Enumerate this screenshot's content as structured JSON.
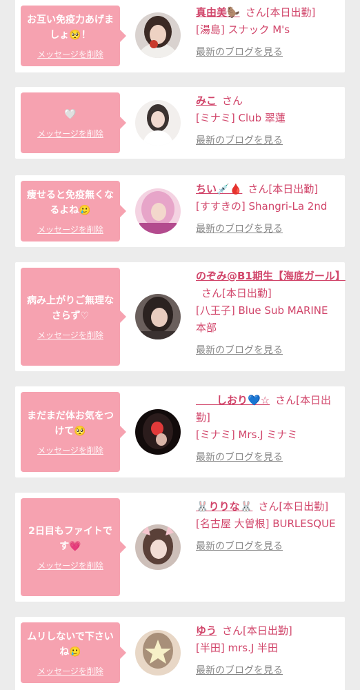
{
  "labels": {
    "delete": "メッセージを削除",
    "blog": "最新のブログを見る",
    "san": "さん"
  },
  "entries": [
    {
      "message": "お互い免疫力あげましょ🥺！",
      "name": "真由美🦫",
      "status": "[本日出勤]",
      "shop": "[湯島] スナック M's",
      "avatar_colors": [
        "#d9d2cf",
        "#3b2a25",
        "#c83a2c"
      ]
    },
    {
      "message": "🤍",
      "name": "みこ",
      "status": "",
      "shop": "[ミナミ] Club 翠蓮",
      "avatar_colors": [
        "#f2efed",
        "#3a3230",
        "#e9d7cf"
      ]
    },
    {
      "message": "痩せると免疫無くなるよね🥲",
      "name": "ちい💉🩸",
      "status": "[本日出勤]",
      "shop": "[すすきの] Shangri-La 2nd",
      "avatar_colors": [
        "#e7a5c9",
        "#b34b8e",
        "#f4d3e2"
      ]
    },
    {
      "message": "病み上がりご無理なさらず♡",
      "name": "のぞみ@B1期生【海底ガール】",
      "status": "[本日出勤]",
      "shop": "[八王子] Blue Sub MARINE 本部",
      "avatar_colors": [
        "#6a5f5c",
        "#2b2220",
        "#e8ccbf"
      ]
    },
    {
      "message": "まだまだ体お気をつけて🥺",
      "name": "　　しおり💙☆",
      "status": "[本日出勤]",
      "shop": "[ミナミ] Mrs.J ミナミ",
      "avatar_colors": [
        "#2b1c1c",
        "#120b0b",
        "#e13a3a"
      ]
    },
    {
      "message": "2日目もファイトです💗",
      "name": "🐰りりな🐰",
      "status": "[本日出勤]",
      "shop": "[名古屋 大曽根] BURLESQUE",
      "avatar_colors": [
        "#cdbfb9",
        "#5a4038",
        "#f1dcd4"
      ]
    },
    {
      "message": "ムリしないで下さいね🥲",
      "name": "ゆう",
      "status": "[本日出勤]",
      "shop": "[半田] mrs.J 半田",
      "avatar_colors": [
        "#e8d7c6",
        "#a88f79",
        "#f7f0c8"
      ]
    }
  ]
}
